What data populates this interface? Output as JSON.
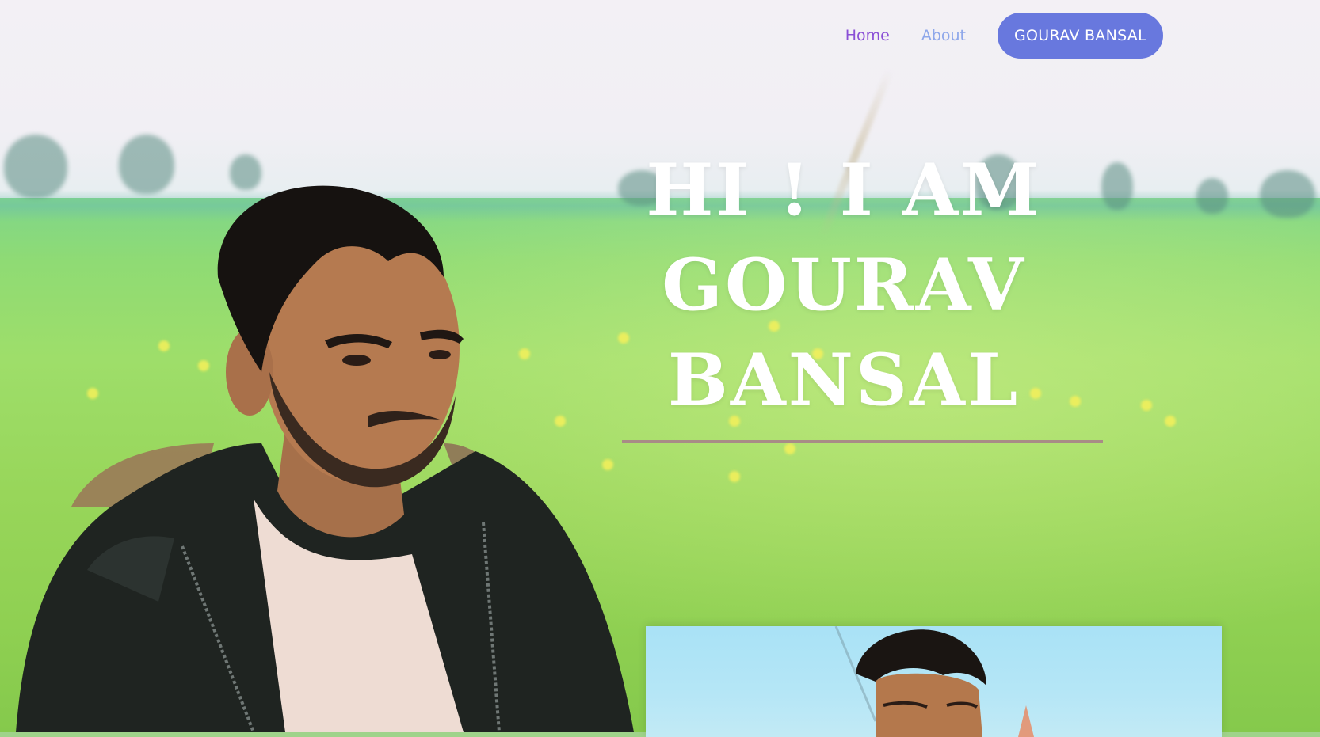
{
  "nav": {
    "home_label": "Home",
    "about_label": "About",
    "cta_label": "GOURAV BANSAL"
  },
  "hero": {
    "line1": "HI ! I AM",
    "line2": "GOURAV",
    "line3": "BANSAL"
  },
  "colors": {
    "home_link": "#8a4fd6",
    "about_link": "#8ea7ea",
    "cta_background": "#6878de",
    "headline": "#ffffff",
    "divider": "#a88c86"
  }
}
